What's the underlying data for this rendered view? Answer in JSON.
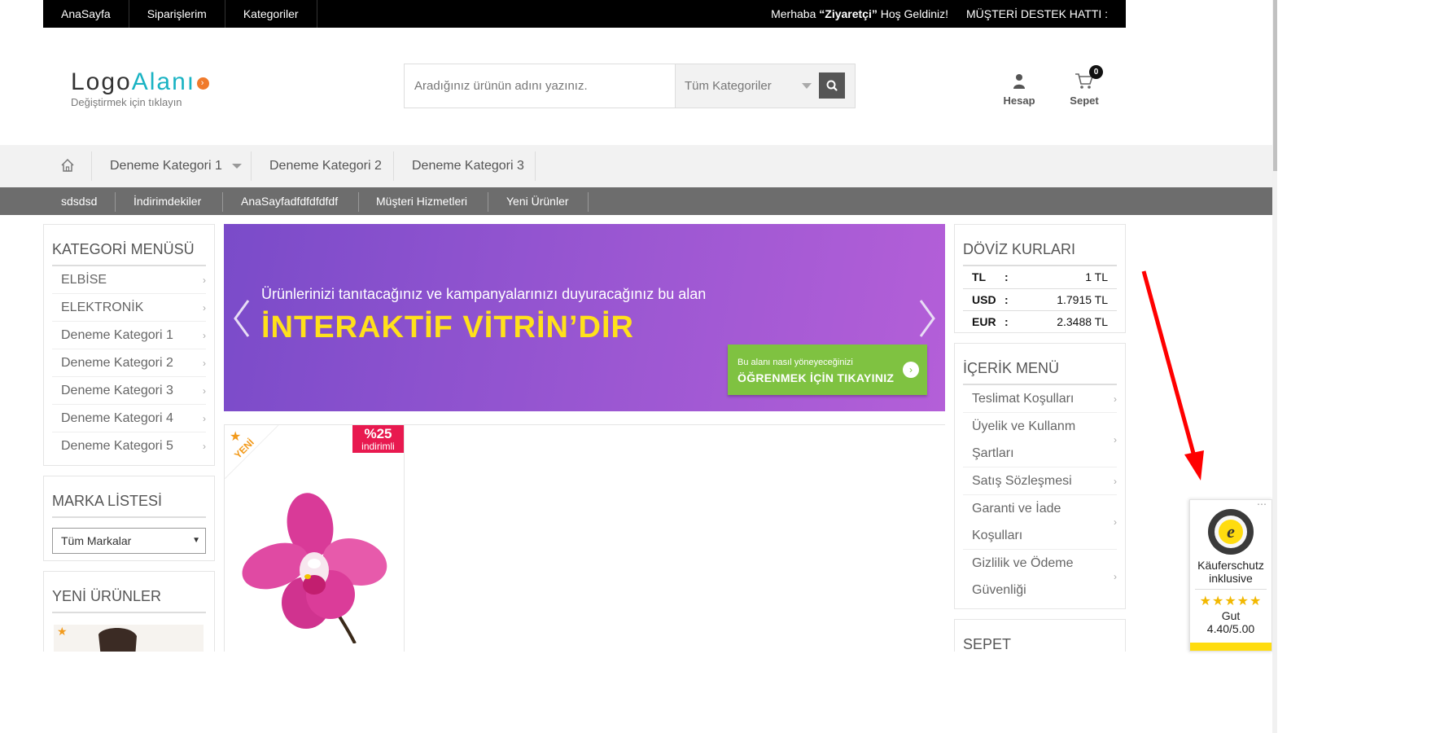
{
  "topbar": {
    "links": [
      "AnaSayfa",
      "Siparişlerim",
      "Kategoriler"
    ],
    "greeting_pre": "Merhaba ",
    "greeting_user": "“Ziyaretçi”",
    "greeting_post": " Hoş Geldiniz!",
    "support": "MÜŞTERİ DESTEK HATTI :"
  },
  "logo": {
    "word_a": "Logo",
    "word_b": "Alanı",
    "sub": "Değiştirmek için tıklayın"
  },
  "search": {
    "placeholder": "Aradığınız ürünün adını yazınız.",
    "category": "Tüm Kategoriler"
  },
  "account": {
    "label": "Hesap"
  },
  "cart": {
    "label": "Sepet",
    "count": "0"
  },
  "catnav": [
    "Deneme Kategori 1",
    "Deneme Kategori 2",
    "Deneme Kategori 3"
  ],
  "greynav": [
    "sdsdsd",
    "İndirimdekiler",
    "AnaSayfadfdfdfdfdf",
    "Müşteri Hizmetleri",
    "Yeni Ürünler"
  ],
  "category_menu": {
    "title": "KATEGORİ MENÜSÜ",
    "items": [
      "ELBİSE",
      "ELEKTRONİK",
      "Deneme Kategori 1",
      "Deneme Kategori 2",
      "Deneme Kategori 3",
      "Deneme Kategori 4",
      "Deneme Kategori 5"
    ]
  },
  "brand_list": {
    "title": "MARKA LİSTESİ",
    "selected": "Tüm Markalar"
  },
  "new_products": {
    "title": "YENİ ÜRÜNLER"
  },
  "banner": {
    "line1": "Ürünlerinizi tanıtacağınız ve kampanyalarınızı duyuracağınız bu alan",
    "line2": "İNTERAKTİF VİTRİN’DİR",
    "cta_small": "Bu alanı nasıl yöneyeceğinizi",
    "cta_big": "ÖĞRENMEK İÇİN TIKAYINIZ"
  },
  "product": {
    "badge_new": "YENİ",
    "discount": "%25",
    "discount_label": "indirimli"
  },
  "currency": {
    "title": "DÖVİZ KURLARI",
    "rows": [
      {
        "code": "TL",
        "sep": ":",
        "value": "1 TL"
      },
      {
        "code": "USD",
        "sep": ":",
        "value": "1.7915 TL"
      },
      {
        "code": "EUR",
        "sep": ":",
        "value": "2.3488 TL"
      }
    ]
  },
  "content_menu": {
    "title": "İÇERİK MENÜ",
    "items": [
      "Teslimat Koşulları",
      "Üyelik ve Kullanm Şartları",
      "Satış Sözleşmesi",
      "Garanti ve İade Koşulları",
      "Gizlilik ve Ödeme Güvenliği"
    ]
  },
  "cart_box": {
    "title": "SEPET"
  },
  "trusted": {
    "line1": "Käuferschutz",
    "line2": "inklusive",
    "rating_word": "Gut",
    "rating": "4.40/5.00",
    "stars": "★★★★★"
  },
  "colors": {
    "banner": "#9b57d2",
    "accent_yellow": "#ffe01b",
    "cta_green": "#7fc241",
    "discount_red": "#e8194f",
    "arrow_red": "#ff0000"
  }
}
